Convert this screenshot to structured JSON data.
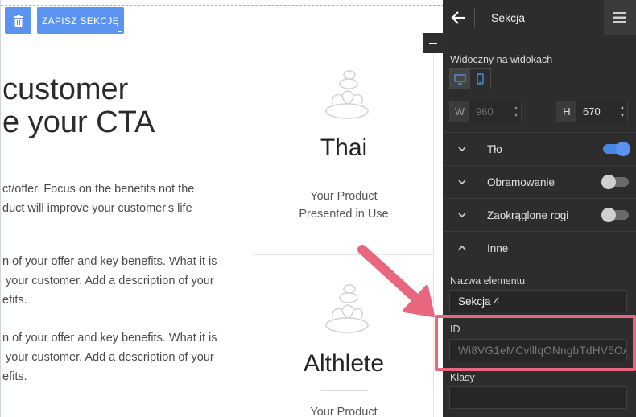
{
  "canvas": {
    "save_button_label": "ZAPISZ SEKCJĘ",
    "headline_lines": [
      "customer",
      "e your CTA"
    ],
    "paragraphs": [
      "ct/offer. Focus on the benefits not the\nduct will improve your customer's life",
      "n of your offer and key benefits. What it is\n your customer. Add a description of your\nefits.",
      "n of your offer and key benefits. What it is\n your customer. Add a description of your\nefits."
    ],
    "cards": [
      {
        "title": "Thai",
        "subtitle": "Your Product\nPresented in Use"
      },
      {
        "title": "Althlete",
        "subtitle": "Your Product"
      }
    ]
  },
  "panel": {
    "title": "Sekcja",
    "visible_on_label": "Widoczny na widokach",
    "width_tag": "W",
    "width_value": "960",
    "height_tag": "H",
    "height_value": "670",
    "rows": [
      {
        "label": "Tło",
        "toggle": true
      },
      {
        "label": "Obramowanie",
        "toggle": false
      },
      {
        "label": "Zaokrąglone rogi",
        "toggle": false
      },
      {
        "label": "Inne"
      }
    ],
    "name_label": "Nazwa elementu",
    "name_value": "Sekcja 4",
    "id_label": "ID",
    "id_value": "Wi8VG1eMCvlllqONngbTdHV5OA",
    "classes_label": "Klasy",
    "classes_value": ""
  },
  "colors": {
    "accent": "#5b93f0",
    "panel_bg": "#2d2d2d",
    "highlight": "#e8677e"
  }
}
